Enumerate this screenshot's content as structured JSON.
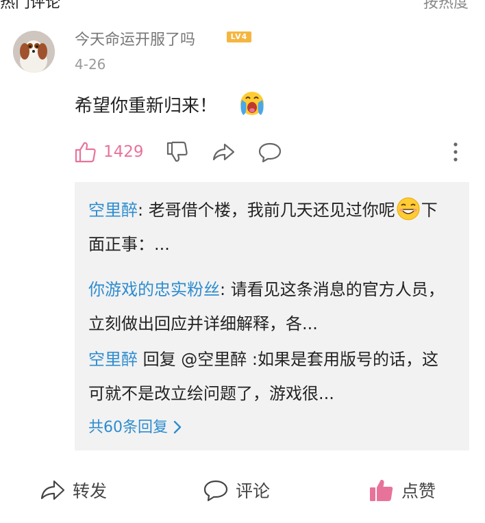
{
  "top_partial": {
    "left": "热门评论",
    "right": "按热度"
  },
  "comment": {
    "username": "今天命运开服了吗",
    "level": "LV4",
    "date": "4-26",
    "text": "希望你重新归来！",
    "emoji": "crying-face-icon",
    "like_count": "1429"
  },
  "replies": [
    {
      "name": "空里醉",
      "sep": ": ",
      "text_before_emoji": "老哥借个楼，我前几天还见过你呢",
      "emoji": "grinning-face-icon",
      "text_after_emoji": "下面正事：..."
    },
    {
      "name": "你游戏的忠实粉丝",
      "sep": ": ",
      "text": "请看见这条消息的官方人员，立刻做出回应并详细解释，各..."
    },
    {
      "name": "空里醉",
      "text": " 回复 @空里醉 :如果是套用版号的话，这可就不是改立绘问题了，游戏很..."
    }
  ],
  "reply_count_label": "共60条回复",
  "bottom_bar": {
    "share_label": "转发",
    "comment_label": "评论",
    "like_label": "点赞"
  },
  "colors": {
    "accent_pink": "#e8739a",
    "link_blue": "#2d8ccf",
    "level_badge": "#f5b640"
  }
}
